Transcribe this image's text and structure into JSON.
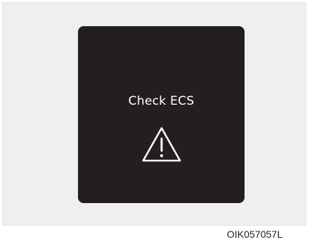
{
  "display": {
    "message": "Check ECS",
    "icon": "warning-triangle-icon"
  },
  "figure_code": "OIK057057L",
  "colors": {
    "display_background": "#231f20",
    "frame_background": "#efefef",
    "text": "#ffffff"
  }
}
